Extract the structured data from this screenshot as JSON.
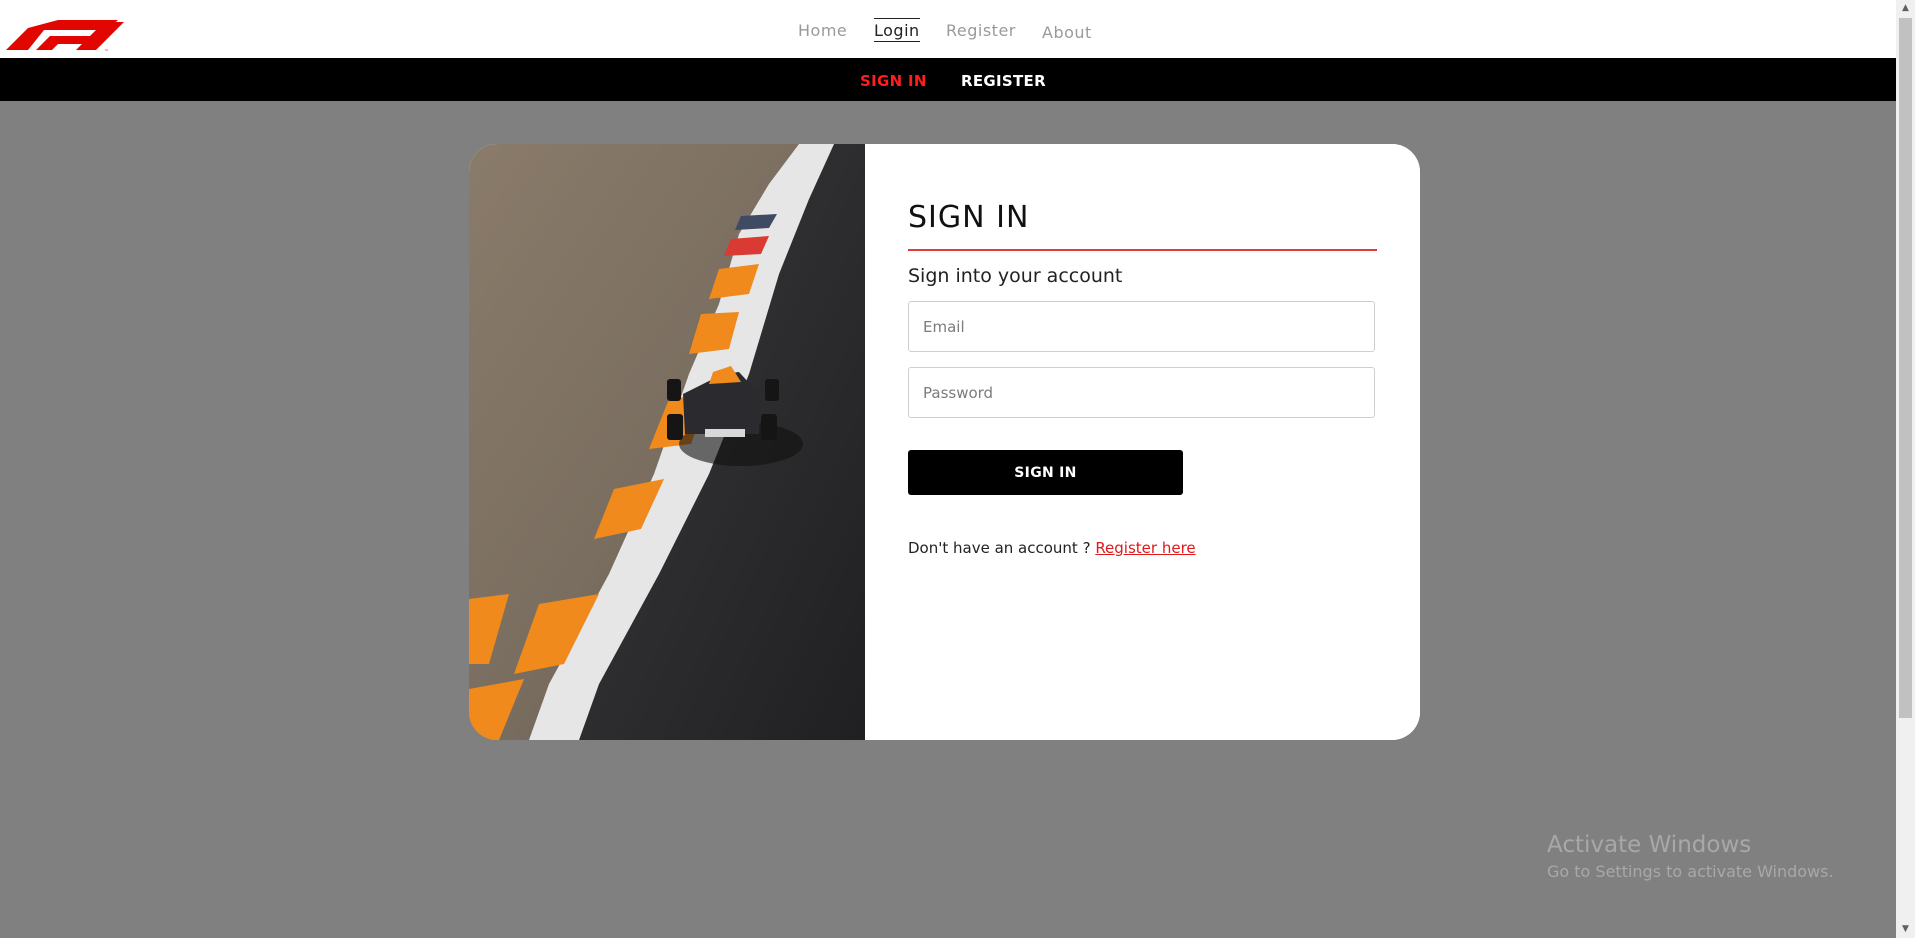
{
  "brand": {
    "logo_name": "F1",
    "accent_color": "#e10600"
  },
  "top_nav": {
    "items": [
      {
        "label": "Home",
        "active": false
      },
      {
        "label": "Login",
        "active": true
      },
      {
        "label": "Register",
        "active": false
      },
      {
        "label": "About",
        "active": false
      }
    ]
  },
  "sub_nav": {
    "items": [
      {
        "label": "SIGN IN",
        "active": true
      },
      {
        "label": "REGISTER",
        "active": false
      }
    ]
  },
  "form": {
    "title": "SIGN IN",
    "subtitle": "Sign into your account",
    "email": {
      "value": "",
      "placeholder": "Email"
    },
    "password": {
      "value": "",
      "placeholder": "Password"
    },
    "submit_label": "SIGN IN",
    "register_prompt": "Don't have an account ? ",
    "register_link": "Register here"
  },
  "image": {
    "description_icon": "race-car-photo"
  },
  "watermark": {
    "title": "Activate Windows",
    "subtitle": "Go to Settings to activate Windows."
  }
}
